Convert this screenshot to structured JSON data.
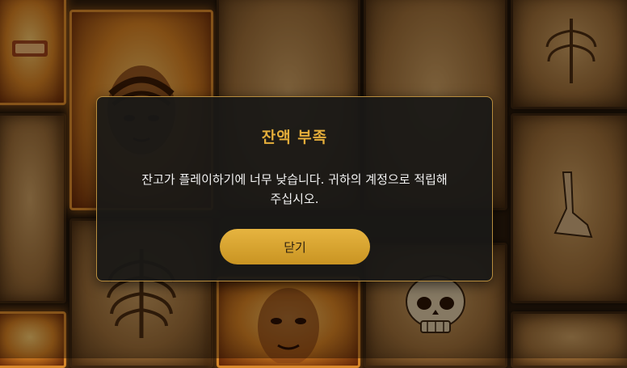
{
  "dialog": {
    "title": "잔액 부족",
    "message_line1": "잔고가 플레이하기에 너무 낮습니다. 귀하의 계정으로 적립해",
    "message_line2": "주십시오.",
    "close_label": "닫기"
  },
  "colors": {
    "accent": "#e4ad3a",
    "button": "#d6a22e",
    "dialog_bg": "#1a1816",
    "border": "#b88d3e"
  },
  "cards": [
    {
      "symbol": "sign-card"
    },
    {
      "symbol": "mummy-head-card"
    },
    {
      "symbol": "blank-card"
    },
    {
      "symbol": "blank-card"
    },
    {
      "symbol": "ribcage-card"
    },
    {
      "symbol": "blank-card"
    },
    {
      "symbol": "foot-skeleton-card"
    },
    {
      "symbol": "ribcage-card"
    },
    {
      "symbol": "screaming-face-card"
    },
    {
      "symbol": "skull-card"
    },
    {
      "symbol": "blank-card"
    }
  ]
}
